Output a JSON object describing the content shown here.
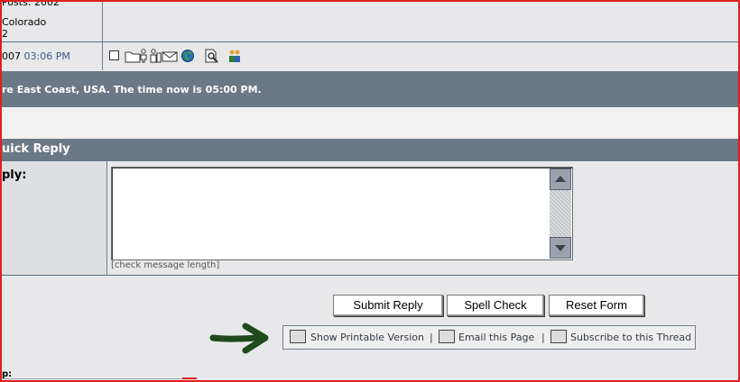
{
  "post": {
    "joined_partial": "Posts: 2002",
    "location_partial": "Colorado",
    "posts_partial": "2",
    "date_partial": "007",
    "time": "03:06 PM"
  },
  "timezone_bar": "re East Coast, USA. The time now is 05:00 PM.",
  "quick_reply": {
    "header": "uick Reply",
    "label": "ply:",
    "message_value": "",
    "check_length": "[check message length]"
  },
  "buttons": {
    "submit": "Submit Reply",
    "spell": "Spell Check",
    "reset": "Reset Form"
  },
  "tools": {
    "printable": "Show Printable Version",
    "email": "Email this Page",
    "subscribe": "Subscribe to this Thread",
    "sep": "|"
  },
  "footer_partial": "p:",
  "colors": {
    "band": "#6b7886",
    "frame_border": "#e0201c",
    "arrow": "#1f4a1b",
    "time_text": "#3d5b86"
  },
  "icons": [
    "checkbox-icon",
    "folder-icon",
    "user-icon",
    "address-book-icon",
    "email-icon",
    "globe-icon",
    "search-icon",
    "buddy-icon",
    "print-icon",
    "email-page-icon",
    "subscribe-icon",
    "arrow-icon"
  ]
}
